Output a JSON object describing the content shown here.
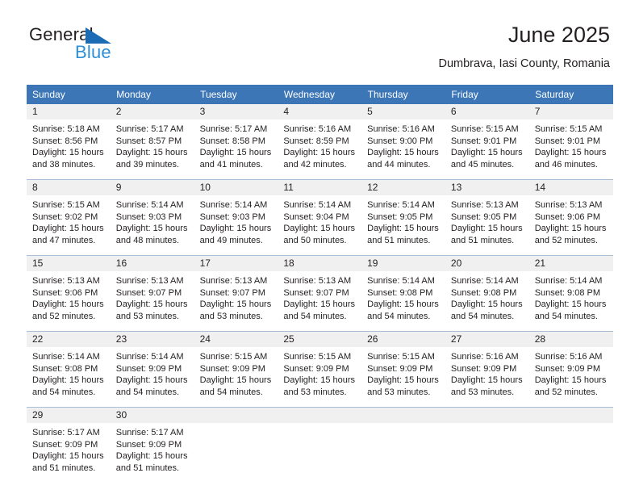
{
  "brand": {
    "word1": "General",
    "word2": "Blue",
    "triangle_color": "#1b6cb5",
    "blue_color": "#2b8fd9"
  },
  "header": {
    "title": "June 2025",
    "subtitle": "Dumbrava, Iasi County, Romania"
  },
  "calendar": {
    "header_bg": "#3c76b6",
    "daynum_bg": "#f0f0f0",
    "weekday_headers": [
      "Sunday",
      "Monday",
      "Tuesday",
      "Wednesday",
      "Thursday",
      "Friday",
      "Saturday"
    ],
    "weeks": [
      [
        {
          "day": "1",
          "sunrise": "Sunrise: 5:18 AM",
          "sunset": "Sunset: 8:56 PM",
          "daylight1": "Daylight: 15 hours",
          "daylight2": "and 38 minutes."
        },
        {
          "day": "2",
          "sunrise": "Sunrise: 5:17 AM",
          "sunset": "Sunset: 8:57 PM",
          "daylight1": "Daylight: 15 hours",
          "daylight2": "and 39 minutes."
        },
        {
          "day": "3",
          "sunrise": "Sunrise: 5:17 AM",
          "sunset": "Sunset: 8:58 PM",
          "daylight1": "Daylight: 15 hours",
          "daylight2": "and 41 minutes."
        },
        {
          "day": "4",
          "sunrise": "Sunrise: 5:16 AM",
          "sunset": "Sunset: 8:59 PM",
          "daylight1": "Daylight: 15 hours",
          "daylight2": "and 42 minutes."
        },
        {
          "day": "5",
          "sunrise": "Sunrise: 5:16 AM",
          "sunset": "Sunset: 9:00 PM",
          "daylight1": "Daylight: 15 hours",
          "daylight2": "and 44 minutes."
        },
        {
          "day": "6",
          "sunrise": "Sunrise: 5:15 AM",
          "sunset": "Sunset: 9:01 PM",
          "daylight1": "Daylight: 15 hours",
          "daylight2": "and 45 minutes."
        },
        {
          "day": "7",
          "sunrise": "Sunrise: 5:15 AM",
          "sunset": "Sunset: 9:01 PM",
          "daylight1": "Daylight: 15 hours",
          "daylight2": "and 46 minutes."
        }
      ],
      [
        {
          "day": "8",
          "sunrise": "Sunrise: 5:15 AM",
          "sunset": "Sunset: 9:02 PM",
          "daylight1": "Daylight: 15 hours",
          "daylight2": "and 47 minutes."
        },
        {
          "day": "9",
          "sunrise": "Sunrise: 5:14 AM",
          "sunset": "Sunset: 9:03 PM",
          "daylight1": "Daylight: 15 hours",
          "daylight2": "and 48 minutes."
        },
        {
          "day": "10",
          "sunrise": "Sunrise: 5:14 AM",
          "sunset": "Sunset: 9:03 PM",
          "daylight1": "Daylight: 15 hours",
          "daylight2": "and 49 minutes."
        },
        {
          "day": "11",
          "sunrise": "Sunrise: 5:14 AM",
          "sunset": "Sunset: 9:04 PM",
          "daylight1": "Daylight: 15 hours",
          "daylight2": "and 50 minutes."
        },
        {
          "day": "12",
          "sunrise": "Sunrise: 5:14 AM",
          "sunset": "Sunset: 9:05 PM",
          "daylight1": "Daylight: 15 hours",
          "daylight2": "and 51 minutes."
        },
        {
          "day": "13",
          "sunrise": "Sunrise: 5:13 AM",
          "sunset": "Sunset: 9:05 PM",
          "daylight1": "Daylight: 15 hours",
          "daylight2": "and 51 minutes."
        },
        {
          "day": "14",
          "sunrise": "Sunrise: 5:13 AM",
          "sunset": "Sunset: 9:06 PM",
          "daylight1": "Daylight: 15 hours",
          "daylight2": "and 52 minutes."
        }
      ],
      [
        {
          "day": "15",
          "sunrise": "Sunrise: 5:13 AM",
          "sunset": "Sunset: 9:06 PM",
          "daylight1": "Daylight: 15 hours",
          "daylight2": "and 52 minutes."
        },
        {
          "day": "16",
          "sunrise": "Sunrise: 5:13 AM",
          "sunset": "Sunset: 9:07 PM",
          "daylight1": "Daylight: 15 hours",
          "daylight2": "and 53 minutes."
        },
        {
          "day": "17",
          "sunrise": "Sunrise: 5:13 AM",
          "sunset": "Sunset: 9:07 PM",
          "daylight1": "Daylight: 15 hours",
          "daylight2": "and 53 minutes."
        },
        {
          "day": "18",
          "sunrise": "Sunrise: 5:13 AM",
          "sunset": "Sunset: 9:07 PM",
          "daylight1": "Daylight: 15 hours",
          "daylight2": "and 54 minutes."
        },
        {
          "day": "19",
          "sunrise": "Sunrise: 5:14 AM",
          "sunset": "Sunset: 9:08 PM",
          "daylight1": "Daylight: 15 hours",
          "daylight2": "and 54 minutes."
        },
        {
          "day": "20",
          "sunrise": "Sunrise: 5:14 AM",
          "sunset": "Sunset: 9:08 PM",
          "daylight1": "Daylight: 15 hours",
          "daylight2": "and 54 minutes."
        },
        {
          "day": "21",
          "sunrise": "Sunrise: 5:14 AM",
          "sunset": "Sunset: 9:08 PM",
          "daylight1": "Daylight: 15 hours",
          "daylight2": "and 54 minutes."
        }
      ],
      [
        {
          "day": "22",
          "sunrise": "Sunrise: 5:14 AM",
          "sunset": "Sunset: 9:08 PM",
          "daylight1": "Daylight: 15 hours",
          "daylight2": "and 54 minutes."
        },
        {
          "day": "23",
          "sunrise": "Sunrise: 5:14 AM",
          "sunset": "Sunset: 9:09 PM",
          "daylight1": "Daylight: 15 hours",
          "daylight2": "and 54 minutes."
        },
        {
          "day": "24",
          "sunrise": "Sunrise: 5:15 AM",
          "sunset": "Sunset: 9:09 PM",
          "daylight1": "Daylight: 15 hours",
          "daylight2": "and 54 minutes."
        },
        {
          "day": "25",
          "sunrise": "Sunrise: 5:15 AM",
          "sunset": "Sunset: 9:09 PM",
          "daylight1": "Daylight: 15 hours",
          "daylight2": "and 53 minutes."
        },
        {
          "day": "26",
          "sunrise": "Sunrise: 5:15 AM",
          "sunset": "Sunset: 9:09 PM",
          "daylight1": "Daylight: 15 hours",
          "daylight2": "and 53 minutes."
        },
        {
          "day": "27",
          "sunrise": "Sunrise: 5:16 AM",
          "sunset": "Sunset: 9:09 PM",
          "daylight1": "Daylight: 15 hours",
          "daylight2": "and 53 minutes."
        },
        {
          "day": "28",
          "sunrise": "Sunrise: 5:16 AM",
          "sunset": "Sunset: 9:09 PM",
          "daylight1": "Daylight: 15 hours",
          "daylight2": "and 52 minutes."
        }
      ],
      [
        {
          "day": "29",
          "sunrise": "Sunrise: 5:17 AM",
          "sunset": "Sunset: 9:09 PM",
          "daylight1": "Daylight: 15 hours",
          "daylight2": "and 51 minutes."
        },
        {
          "day": "30",
          "sunrise": "Sunrise: 5:17 AM",
          "sunset": "Sunset: 9:09 PM",
          "daylight1": "Daylight: 15 hours",
          "daylight2": "and 51 minutes."
        },
        {
          "day": "",
          "sunrise": "",
          "sunset": "",
          "daylight1": "",
          "daylight2": ""
        },
        {
          "day": "",
          "sunrise": "",
          "sunset": "",
          "daylight1": "",
          "daylight2": ""
        },
        {
          "day": "",
          "sunrise": "",
          "sunset": "",
          "daylight1": "",
          "daylight2": ""
        },
        {
          "day": "",
          "sunrise": "",
          "sunset": "",
          "daylight1": "",
          "daylight2": ""
        },
        {
          "day": "",
          "sunrise": "",
          "sunset": "",
          "daylight1": "",
          "daylight2": ""
        }
      ]
    ]
  }
}
